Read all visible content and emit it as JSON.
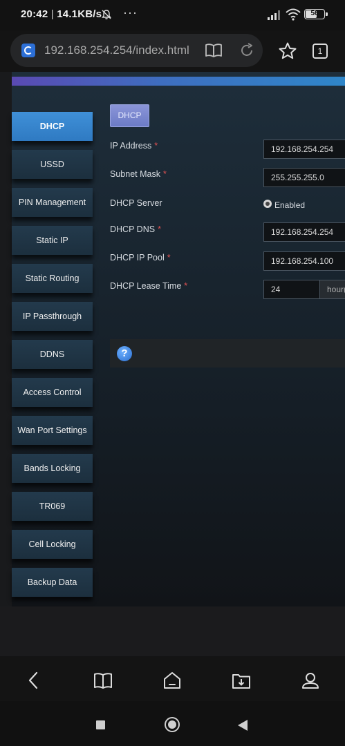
{
  "status_bar": {
    "time": "20:42",
    "separator": "|",
    "speed": "14.1KB/s",
    "more": "···",
    "battery": "56",
    "icons": [
      "bell-off-icon",
      "signal-icon",
      "wifi-icon",
      "battery-icon"
    ]
  },
  "browser": {
    "url": "192.168.254.254/index.html",
    "tab_count": "1",
    "icons": [
      "site-icon",
      "reader-mode-icon",
      "reload-icon",
      "star-icon",
      "tabs-icon"
    ]
  },
  "sidebar": {
    "items": [
      {
        "label": "DHCP",
        "active": true
      },
      {
        "label": "USSD"
      },
      {
        "label": "PIN Management"
      },
      {
        "label": "Static IP"
      },
      {
        "label": "Static Routing"
      },
      {
        "label": "IP Passthrough"
      },
      {
        "label": "DDNS"
      },
      {
        "label": "Access Control"
      },
      {
        "label": "Wan Port Settings"
      },
      {
        "label": "Bands Locking"
      },
      {
        "label": "TR069"
      },
      {
        "label": "Cell Locking"
      },
      {
        "label": "Backup Data"
      }
    ]
  },
  "main": {
    "tab_label": "DHCP",
    "required_mark": "*",
    "fields": {
      "ip_address": {
        "label": "IP Address",
        "value": "192.168.254.254"
      },
      "subnet_mask": {
        "label": "Subnet Mask",
        "value": "255.255.255.0"
      },
      "dhcp_server": {
        "label": "DHCP Server",
        "option": "Enabled"
      },
      "dhcp_dns": {
        "label": "DHCP DNS",
        "value": "192.168.254.254"
      },
      "dhcp_ip_pool": {
        "label": "DHCP IP Pool",
        "value": "192.168.254.100"
      },
      "dhcp_lease_time": {
        "label": "DHCP Lease Time",
        "value": "24",
        "unit": "hour("
      }
    },
    "help_glyph": "?"
  },
  "bottom_nav": {
    "icons": [
      "back-arrow-icon",
      "bookmarks-icon",
      "home-icon",
      "downloads-icon",
      "profile-icon"
    ]
  },
  "colors": {
    "accent_active": "#3a87d0",
    "tab_bg": "#7a86cf",
    "required": "#e05252",
    "panel_bg": "#1e2e3b"
  }
}
